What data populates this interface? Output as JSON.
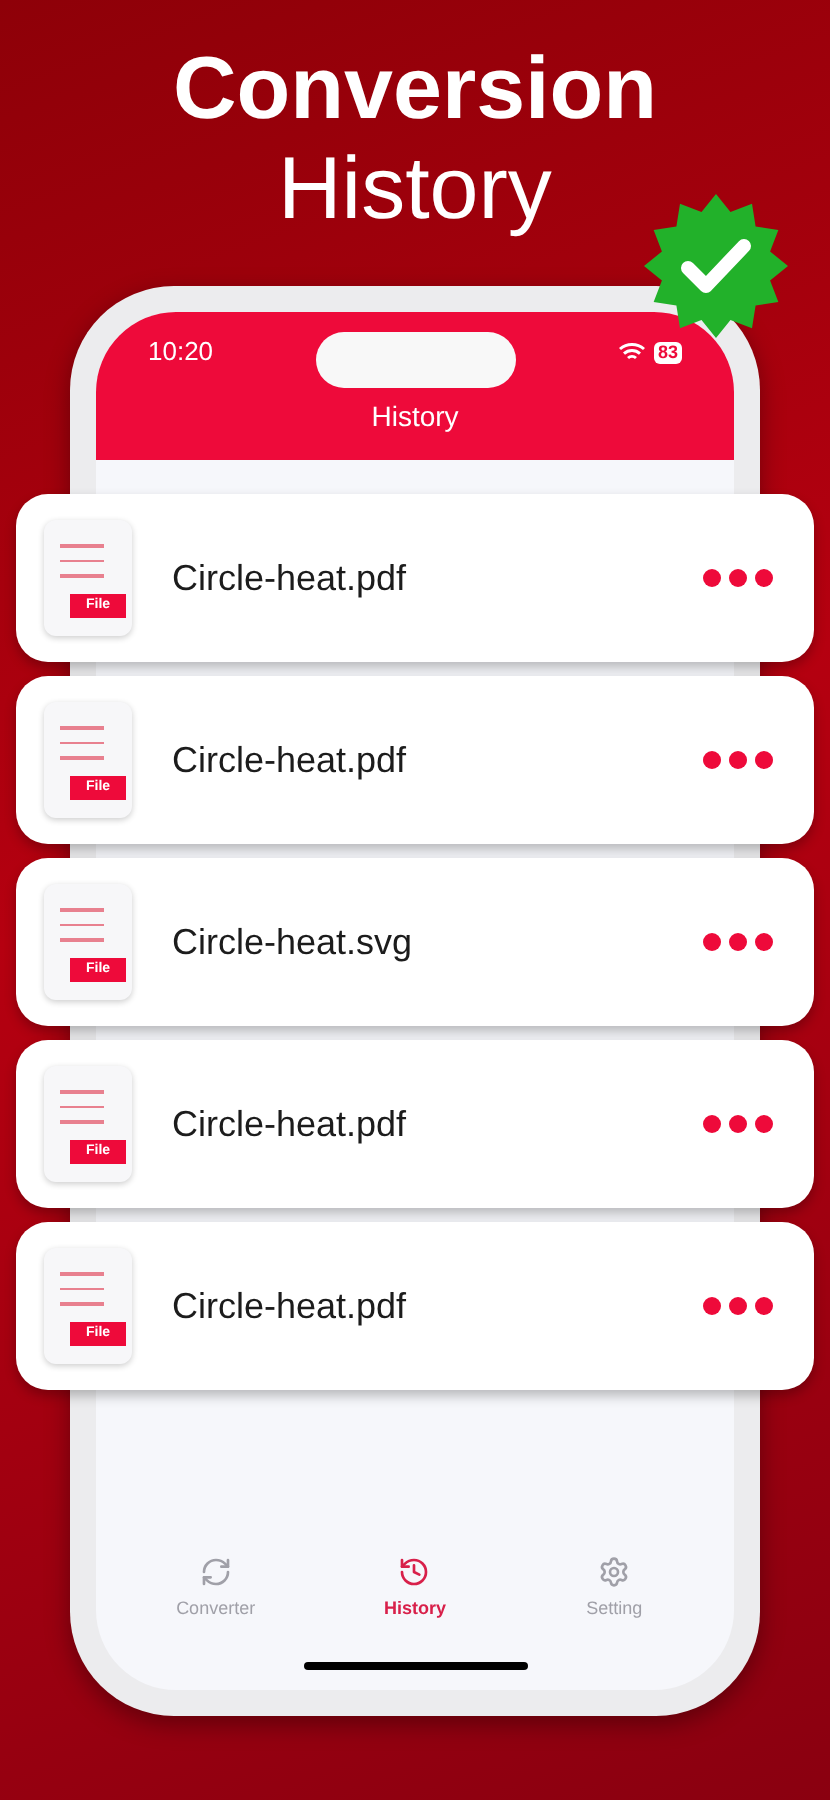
{
  "headline": {
    "line_1": "Conversion",
    "line_2": "History"
  },
  "status_bar": {
    "time": "10:20",
    "battery": "83"
  },
  "nav_title": "History",
  "files": [
    {
      "name": "Circle-heat.pdf",
      "icon_label": "File"
    },
    {
      "name": "Circle-heat.pdf",
      "icon_label": "File"
    },
    {
      "name": "Circle-heat.svg",
      "icon_label": "File"
    },
    {
      "name": "Circle-heat.pdf",
      "icon_label": "File"
    },
    {
      "name": "Circle-heat.pdf",
      "icon_label": "File"
    }
  ],
  "tab_bar": [
    {
      "label": "Converter",
      "selected": false
    },
    {
      "label": "History",
      "selected": true
    },
    {
      "label": "Setting",
      "selected": false
    }
  ]
}
